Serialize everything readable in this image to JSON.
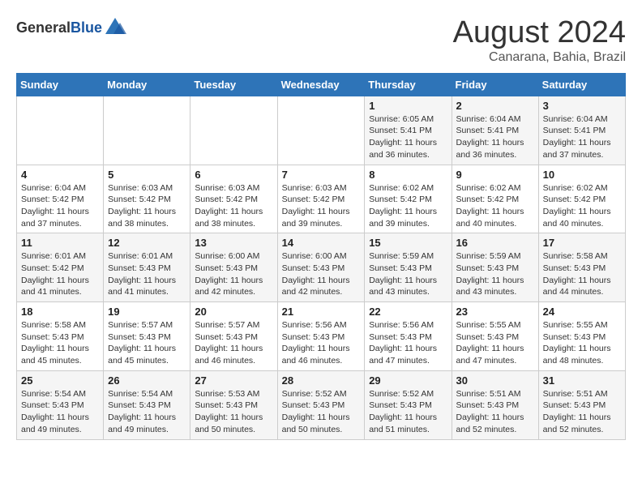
{
  "header": {
    "logo_general": "General",
    "logo_blue": "Blue",
    "title": "August 2024",
    "subtitle": "Canarana, Bahia, Brazil"
  },
  "calendar": {
    "weekdays": [
      "Sunday",
      "Monday",
      "Tuesday",
      "Wednesday",
      "Thursday",
      "Friday",
      "Saturday"
    ],
    "weeks": [
      [
        {
          "day": "",
          "details": ""
        },
        {
          "day": "",
          "details": ""
        },
        {
          "day": "",
          "details": ""
        },
        {
          "day": "",
          "details": ""
        },
        {
          "day": "1",
          "details": "Sunrise: 6:05 AM\nSunset: 5:41 PM\nDaylight: 11 hours and 36 minutes."
        },
        {
          "day": "2",
          "details": "Sunrise: 6:04 AM\nSunset: 5:41 PM\nDaylight: 11 hours and 36 minutes."
        },
        {
          "day": "3",
          "details": "Sunrise: 6:04 AM\nSunset: 5:41 PM\nDaylight: 11 hours and 37 minutes."
        }
      ],
      [
        {
          "day": "4",
          "details": "Sunrise: 6:04 AM\nSunset: 5:42 PM\nDaylight: 11 hours and 37 minutes."
        },
        {
          "day": "5",
          "details": "Sunrise: 6:03 AM\nSunset: 5:42 PM\nDaylight: 11 hours and 38 minutes."
        },
        {
          "day": "6",
          "details": "Sunrise: 6:03 AM\nSunset: 5:42 PM\nDaylight: 11 hours and 38 minutes."
        },
        {
          "day": "7",
          "details": "Sunrise: 6:03 AM\nSunset: 5:42 PM\nDaylight: 11 hours and 39 minutes."
        },
        {
          "day": "8",
          "details": "Sunrise: 6:02 AM\nSunset: 5:42 PM\nDaylight: 11 hours and 39 minutes."
        },
        {
          "day": "9",
          "details": "Sunrise: 6:02 AM\nSunset: 5:42 PM\nDaylight: 11 hours and 40 minutes."
        },
        {
          "day": "10",
          "details": "Sunrise: 6:02 AM\nSunset: 5:42 PM\nDaylight: 11 hours and 40 minutes."
        }
      ],
      [
        {
          "day": "11",
          "details": "Sunrise: 6:01 AM\nSunset: 5:42 PM\nDaylight: 11 hours and 41 minutes."
        },
        {
          "day": "12",
          "details": "Sunrise: 6:01 AM\nSunset: 5:43 PM\nDaylight: 11 hours and 41 minutes."
        },
        {
          "day": "13",
          "details": "Sunrise: 6:00 AM\nSunset: 5:43 PM\nDaylight: 11 hours and 42 minutes."
        },
        {
          "day": "14",
          "details": "Sunrise: 6:00 AM\nSunset: 5:43 PM\nDaylight: 11 hours and 42 minutes."
        },
        {
          "day": "15",
          "details": "Sunrise: 5:59 AM\nSunset: 5:43 PM\nDaylight: 11 hours and 43 minutes."
        },
        {
          "day": "16",
          "details": "Sunrise: 5:59 AM\nSunset: 5:43 PM\nDaylight: 11 hours and 43 minutes."
        },
        {
          "day": "17",
          "details": "Sunrise: 5:58 AM\nSunset: 5:43 PM\nDaylight: 11 hours and 44 minutes."
        }
      ],
      [
        {
          "day": "18",
          "details": "Sunrise: 5:58 AM\nSunset: 5:43 PM\nDaylight: 11 hours and 45 minutes."
        },
        {
          "day": "19",
          "details": "Sunrise: 5:57 AM\nSunset: 5:43 PM\nDaylight: 11 hours and 45 minutes."
        },
        {
          "day": "20",
          "details": "Sunrise: 5:57 AM\nSunset: 5:43 PM\nDaylight: 11 hours and 46 minutes."
        },
        {
          "day": "21",
          "details": "Sunrise: 5:56 AM\nSunset: 5:43 PM\nDaylight: 11 hours and 46 minutes."
        },
        {
          "day": "22",
          "details": "Sunrise: 5:56 AM\nSunset: 5:43 PM\nDaylight: 11 hours and 47 minutes."
        },
        {
          "day": "23",
          "details": "Sunrise: 5:55 AM\nSunset: 5:43 PM\nDaylight: 11 hours and 47 minutes."
        },
        {
          "day": "24",
          "details": "Sunrise: 5:55 AM\nSunset: 5:43 PM\nDaylight: 11 hours and 48 minutes."
        }
      ],
      [
        {
          "day": "25",
          "details": "Sunrise: 5:54 AM\nSunset: 5:43 PM\nDaylight: 11 hours and 49 minutes."
        },
        {
          "day": "26",
          "details": "Sunrise: 5:54 AM\nSunset: 5:43 PM\nDaylight: 11 hours and 49 minutes."
        },
        {
          "day": "27",
          "details": "Sunrise: 5:53 AM\nSunset: 5:43 PM\nDaylight: 11 hours and 50 minutes."
        },
        {
          "day": "28",
          "details": "Sunrise: 5:52 AM\nSunset: 5:43 PM\nDaylight: 11 hours and 50 minutes."
        },
        {
          "day": "29",
          "details": "Sunrise: 5:52 AM\nSunset: 5:43 PM\nDaylight: 11 hours and 51 minutes."
        },
        {
          "day": "30",
          "details": "Sunrise: 5:51 AM\nSunset: 5:43 PM\nDaylight: 11 hours and 52 minutes."
        },
        {
          "day": "31",
          "details": "Sunrise: 5:51 AM\nSunset: 5:43 PM\nDaylight: 11 hours and 52 minutes."
        }
      ]
    ]
  }
}
